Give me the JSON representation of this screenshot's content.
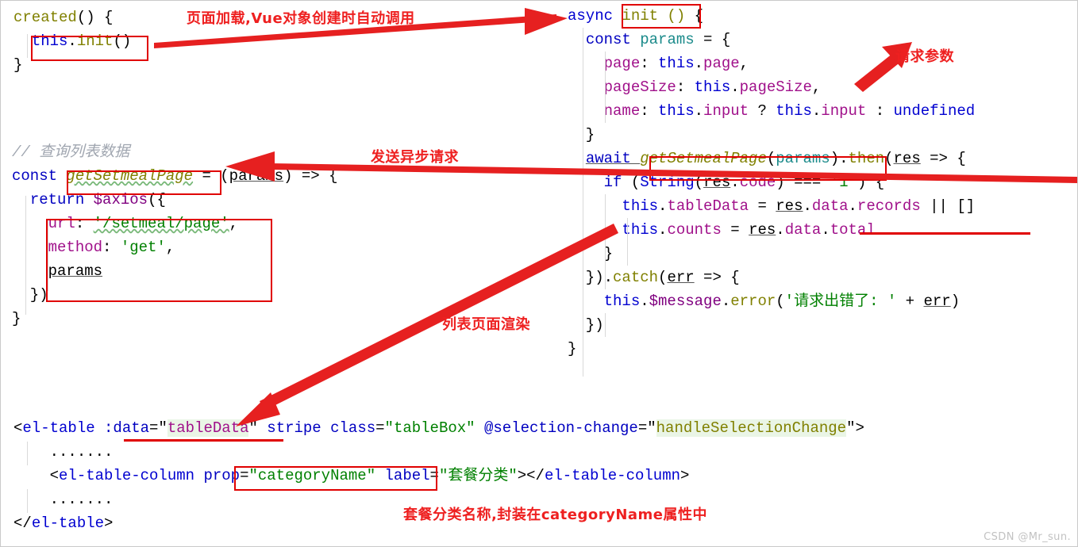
{
  "watermark": "CSDN @Mr_sun.",
  "annotations": [
    {
      "id": "created-note",
      "text": "页面加载,Vue对象创建时自动调用"
    },
    {
      "id": "async-note",
      "text": "发送异步请求"
    },
    {
      "id": "params-note",
      "text": "请求参数"
    },
    {
      "id": "render-note",
      "text": "列表页面渲染"
    },
    {
      "id": "category-note",
      "text": "套餐分类名称,封装在categoryName属性中"
    }
  ],
  "left_top": {
    "lines": [
      {
        "tokens": [
          {
            "t": "created",
            "c": "olive"
          },
          {
            "t": "() {",
            "c": "blk"
          }
        ]
      },
      {
        "tokens": [
          {
            "t": "  ",
            "c": "blk"
          },
          {
            "t": "this",
            "c": "blue"
          },
          {
            "t": ".",
            "c": "blk"
          },
          {
            "t": "init",
            "c": "olive"
          },
          {
            "t": "()",
            "c": "blk"
          }
        ]
      },
      {
        "tokens": [
          {
            "t": "}",
            "c": "blk"
          }
        ]
      }
    ]
  },
  "left_mid": {
    "lines": [
      {
        "tokens": [
          {
            "t": "// 查询列表数据",
            "c": "cmt"
          }
        ]
      },
      {
        "tokens": [
          {
            "t": "const ",
            "c": "kw"
          },
          {
            "t": "getSetmealPage",
            "c": "olive ital sq"
          },
          {
            "t": " = (",
            "c": "blk"
          },
          {
            "t": "params",
            "c": "u"
          },
          {
            "t": ") => {",
            "c": "blk"
          }
        ]
      },
      {
        "tokens": [
          {
            "t": "  ",
            "c": "blk"
          },
          {
            "t": "return ",
            "c": "kw"
          },
          {
            "t": "$axios",
            "c": "purple"
          },
          {
            "t": "({",
            "c": "blk"
          }
        ]
      },
      {
        "tokens": [
          {
            "t": "    ",
            "c": "blk"
          },
          {
            "t": "url",
            "c": "magenta"
          },
          {
            "t": ": ",
            "c": "blk"
          },
          {
            "t": "'/setmeal/page'",
            "c": "green sq"
          },
          {
            "t": ",",
            "c": "blk"
          }
        ]
      },
      {
        "tokens": [
          {
            "t": "    ",
            "c": "blk"
          },
          {
            "t": "method",
            "c": "magenta"
          },
          {
            "t": ": ",
            "c": "blk"
          },
          {
            "t": "'get'",
            "c": "green"
          },
          {
            "t": ",",
            "c": "blk"
          }
        ]
      },
      {
        "tokens": [
          {
            "t": "    ",
            "c": "blk"
          },
          {
            "t": "params",
            "c": "u"
          }
        ]
      },
      {
        "tokens": [
          {
            "t": "  })",
            "c": "blk"
          }
        ]
      },
      {
        "tokens": [
          {
            "t": "}",
            "c": "blk"
          }
        ]
      }
    ]
  },
  "right": {
    "lines": [
      {
        "tokens": [
          {
            "t": "async ",
            "c": "blue"
          },
          {
            "t": "init ()",
            "c": "olive"
          },
          {
            "t": " {",
            "c": "blk"
          }
        ]
      },
      {
        "tokens": [
          {
            "t": "  ",
            "c": "blk"
          },
          {
            "t": "const ",
            "c": "kw"
          },
          {
            "t": "params",
            "c": "teal"
          },
          {
            "t": " = {",
            "c": "blk"
          }
        ]
      },
      {
        "tokens": [
          {
            "t": "    ",
            "c": "blk"
          },
          {
            "t": "page",
            "c": "magenta"
          },
          {
            "t": ": ",
            "c": "blk"
          },
          {
            "t": "this",
            "c": "blue"
          },
          {
            "t": ".",
            "c": "blk"
          },
          {
            "t": "page",
            "c": "magenta"
          },
          {
            "t": ",",
            "c": "blk"
          }
        ]
      },
      {
        "tokens": [
          {
            "t": "    ",
            "c": "blk"
          },
          {
            "t": "pageSize",
            "c": "magenta"
          },
          {
            "t": ": ",
            "c": "blk"
          },
          {
            "t": "this",
            "c": "blue"
          },
          {
            "t": ".",
            "c": "blk"
          },
          {
            "t": "pageSize",
            "c": "magenta"
          },
          {
            "t": ",",
            "c": "blk"
          }
        ]
      },
      {
        "tokens": [
          {
            "t": "    ",
            "c": "blk"
          },
          {
            "t": "name",
            "c": "magenta"
          },
          {
            "t": ": ",
            "c": "blk"
          },
          {
            "t": "this",
            "c": "blue"
          },
          {
            "t": ".",
            "c": "blk"
          },
          {
            "t": "input",
            "c": "magenta"
          },
          {
            "t": " ? ",
            "c": "blk"
          },
          {
            "t": "this",
            "c": "blue"
          },
          {
            "t": ".",
            "c": "blk"
          },
          {
            "t": "input",
            "c": "magenta"
          },
          {
            "t": " : ",
            "c": "blk"
          },
          {
            "t": "undefined",
            "c": "blue"
          }
        ]
      },
      {
        "tokens": [
          {
            "t": "  }",
            "c": "blk"
          }
        ]
      },
      {
        "tokens": [
          {
            "t": "  ",
            "c": "blk"
          },
          {
            "t": "await ",
            "c": "kw u"
          },
          {
            "t": "getSetmealPage",
            "c": "olive ital"
          },
          {
            "t": "(",
            "c": "blk"
          },
          {
            "t": "params",
            "c": "teal"
          },
          {
            "t": ")",
            "c": "blk"
          },
          {
            "t": ".",
            "c": "blk"
          },
          {
            "t": "then",
            "c": "olive"
          },
          {
            "t": "(",
            "c": "blk"
          },
          {
            "t": "res",
            "c": "u"
          },
          {
            "t": " => {",
            "c": "blk"
          }
        ]
      },
      {
        "tokens": [
          {
            "t": "    ",
            "c": "blk"
          },
          {
            "t": "if ",
            "c": "kw"
          },
          {
            "t": "(",
            "c": "blk"
          },
          {
            "t": "String",
            "c": "blue"
          },
          {
            "t": "(",
            "c": "blk"
          },
          {
            "t": "res",
            "c": "u"
          },
          {
            "t": ".",
            "c": "blk"
          },
          {
            "t": "code",
            "c": "magenta"
          },
          {
            "t": ") === ",
            "c": "blk"
          },
          {
            "t": "'1'",
            "c": "green"
          },
          {
            "t": ") {",
            "c": "blk"
          }
        ]
      },
      {
        "tokens": [
          {
            "t": "      ",
            "c": "blk"
          },
          {
            "t": "this",
            "c": "blue"
          },
          {
            "t": ".",
            "c": "blk"
          },
          {
            "t": "tableData",
            "c": "magenta"
          },
          {
            "t": " = ",
            "c": "blk"
          },
          {
            "t": "res",
            "c": "u"
          },
          {
            "t": ".",
            "c": "blk"
          },
          {
            "t": "data",
            "c": "magenta"
          },
          {
            "t": ".",
            "c": "blk"
          },
          {
            "t": "records",
            "c": "magenta"
          },
          {
            "t": " || []",
            "c": "blk"
          }
        ]
      },
      {
        "tokens": [
          {
            "t": "      ",
            "c": "blk"
          },
          {
            "t": "this",
            "c": "blue"
          },
          {
            "t": ".",
            "c": "blk"
          },
          {
            "t": "counts",
            "c": "magenta"
          },
          {
            "t": " = ",
            "c": "blk"
          },
          {
            "t": "res",
            "c": "u"
          },
          {
            "t": ".",
            "c": "blk"
          },
          {
            "t": "data",
            "c": "magenta"
          },
          {
            "t": ".",
            "c": "blk"
          },
          {
            "t": "total",
            "c": "magenta"
          }
        ]
      },
      {
        "tokens": [
          {
            "t": "    }",
            "c": "blk"
          }
        ]
      },
      {
        "tokens": [
          {
            "t": "  })",
            "c": "blk"
          },
          {
            "t": ".",
            "c": "blk"
          },
          {
            "t": "catch",
            "c": "olive"
          },
          {
            "t": "(",
            "c": "blk"
          },
          {
            "t": "err",
            "c": "u"
          },
          {
            "t": " => {",
            "c": "blk"
          }
        ]
      },
      {
        "tokens": [
          {
            "t": "    ",
            "c": "blk"
          },
          {
            "t": "this",
            "c": "blue"
          },
          {
            "t": ".",
            "c": "blk"
          },
          {
            "t": "$message",
            "c": "purple"
          },
          {
            "t": ".",
            "c": "blk"
          },
          {
            "t": "error",
            "c": "olive"
          },
          {
            "t": "(",
            "c": "blk"
          },
          {
            "t": "'请求出错了: '",
            "c": "green"
          },
          {
            "t": " + ",
            "c": "blk"
          },
          {
            "t": "err",
            "c": "u"
          },
          {
            "t": ")",
            "c": "blk"
          }
        ]
      },
      {
        "tokens": [
          {
            "t": "  })",
            "c": "blk"
          }
        ]
      },
      {
        "tokens": [
          {
            "t": "}",
            "c": "blk"
          }
        ]
      }
    ]
  },
  "bottom": {
    "lines": [
      {
        "tokens": [
          {
            "t": "<",
            "c": "blk"
          },
          {
            "t": "el-table",
            "c": "blue"
          },
          {
            "t": " ",
            "c": "blk"
          },
          {
            "t": ":data",
            "c": "kw"
          },
          {
            "t": "=",
            "c": "blk"
          },
          {
            "t": "\"",
            "c": "blk"
          },
          {
            "t": "tableData",
            "c": "magenta hl"
          },
          {
            "t": "\"",
            "c": "blk"
          },
          {
            "t": " ",
            "c": "blk"
          },
          {
            "t": "stripe",
            "c": "kw"
          },
          {
            "t": " ",
            "c": "blk"
          },
          {
            "t": "class",
            "c": "kw"
          },
          {
            "t": "=",
            "c": "blk"
          },
          {
            "t": "\"tableBox\"",
            "c": "green"
          },
          {
            "t": " ",
            "c": "blk"
          },
          {
            "t": "@selection-change",
            "c": "kw"
          },
          {
            "t": "=",
            "c": "blk"
          },
          {
            "t": "\"",
            "c": "blk"
          },
          {
            "t": "handleSelectionChange",
            "c": "olive hl"
          },
          {
            "t": "\"",
            "c": "blk"
          },
          {
            "t": ">",
            "c": "blk"
          }
        ]
      },
      {
        "tokens": [
          {
            "t": "    .......",
            "c": "blk"
          }
        ]
      },
      {
        "tokens": [
          {
            "t": "    <",
            "c": "blk"
          },
          {
            "t": "el-table-column",
            "c": "blue"
          },
          {
            "t": " ",
            "c": "blk"
          },
          {
            "t": "prop",
            "c": "kw"
          },
          {
            "t": "=",
            "c": "blk"
          },
          {
            "t": "\"categoryName\"",
            "c": "green"
          },
          {
            "t": " ",
            "c": "blk"
          },
          {
            "t": "label",
            "c": "kw"
          },
          {
            "t": "=",
            "c": "blk"
          },
          {
            "t": "\"套餐分类\"",
            "c": "green"
          },
          {
            "t": "></",
            "c": "blk"
          },
          {
            "t": "el-table-column",
            "c": "blue"
          },
          {
            "t": ">",
            "c": "blk"
          }
        ]
      },
      {
        "tokens": [
          {
            "t": "    .......",
            "c": "blk"
          }
        ]
      },
      {
        "tokens": [
          {
            "t": "</",
            "c": "blk"
          },
          {
            "t": "el-table",
            "c": "blue"
          },
          {
            "t": ">",
            "c": "blk"
          }
        ]
      }
    ]
  }
}
